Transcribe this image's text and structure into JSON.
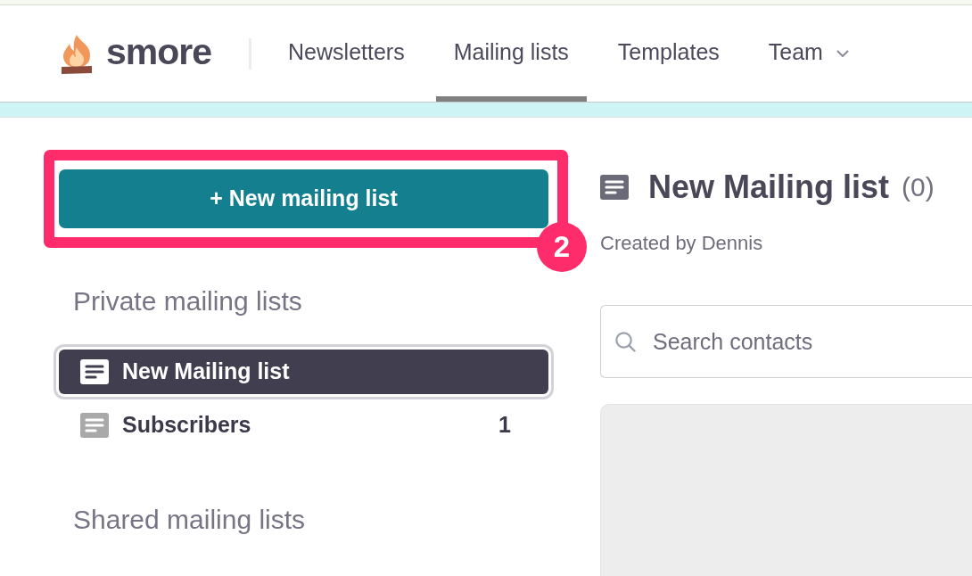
{
  "header": {
    "logo": "smore",
    "tabs": [
      {
        "label": "Newsletters",
        "selected": false,
        "has_menu": false
      },
      {
        "label": "Mailing lists",
        "selected": true,
        "has_menu": false
      },
      {
        "label": "Templates",
        "selected": false,
        "has_menu": false
      },
      {
        "label": "Team",
        "selected": false,
        "has_menu": true
      }
    ]
  },
  "sidebar": {
    "new_list_button": {
      "label": "+ New mailing list",
      "highlighted": true,
      "step": "2"
    },
    "sections": [
      {
        "title": "Private mailing lists",
        "items": [
          {
            "name": "New Mailing list",
            "selected": true
          },
          {
            "name": "Subscribers",
            "selected": false,
            "count": "1"
          }
        ]
      },
      {
        "title": "Shared mailing lists"
      }
    ]
  },
  "list_view": {
    "title": "New Mailing list",
    "count": "(0)",
    "created_by": "Created by Dennis",
    "search": {
      "placeholder": "Search contacts"
    }
  }
}
